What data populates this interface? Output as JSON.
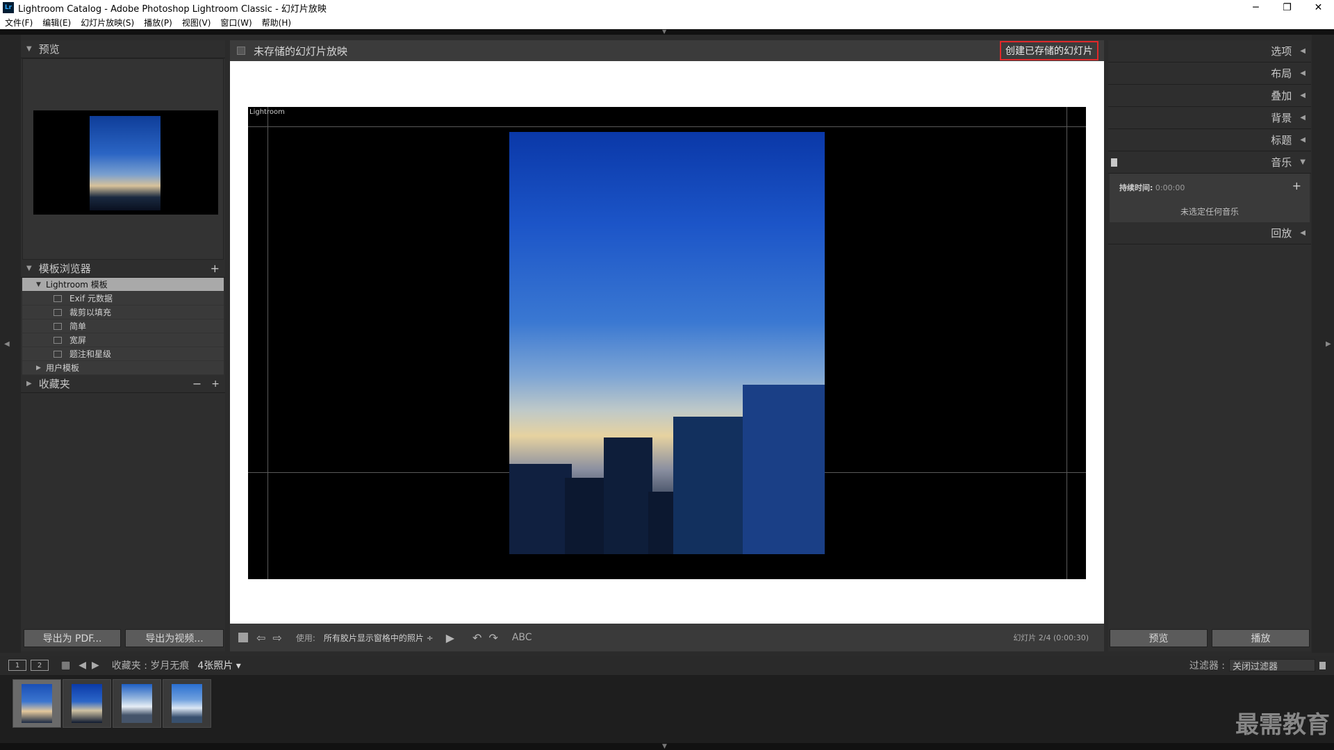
{
  "window": {
    "title": "Lightroom Catalog - Adobe Photoshop Lightroom Classic - 幻灯片放映",
    "logo": "Lr",
    "minimize": "─",
    "restore": "❐",
    "close": "✕"
  },
  "menu": [
    "文件(F)",
    "编辑(E)",
    "幻灯片放映(S)",
    "播放(P)",
    "视图(V)",
    "窗口(W)",
    "帮助(H)"
  ],
  "left": {
    "preview_title": "预览",
    "template_browser_title": "模板浏览器",
    "templates": {
      "folder": "Lightroom 模板",
      "items": [
        "Exif 元数据",
        "裁剪以填充",
        "简单",
        "宽屏",
        "题注和星级"
      ],
      "user_folder": "用户模板"
    },
    "collections_title": "收藏夹",
    "export_pdf": "导出为 PDF...",
    "export_video": "导出为视频..."
  },
  "center": {
    "title": "未存储的幻灯片放映",
    "create_button": "创建已存储的幻灯片",
    "slide_identity": "Lightroom"
  },
  "toolbar": {
    "use_label": "使用:",
    "use_value": "所有胶片显示窗格中的照片 ÷",
    "abc": "ABC",
    "counter": "幻灯片 2/4 (0:00:30)"
  },
  "right": {
    "sections": [
      "选项",
      "布局",
      "叠加",
      "背景",
      "标题",
      "音乐",
      "回放"
    ],
    "music": {
      "duration_label": "持续时间:",
      "duration_value": "0:00:00",
      "none_selected": "未选定任何音乐"
    },
    "preview_button": "预览",
    "play_button": "播放"
  },
  "filmstrip": {
    "page1": "1",
    "page2": "2",
    "collection": "收藏夹 : 岁月无痕",
    "count": "4张照片 ▾",
    "filter_label": "过滤器 :",
    "filter_value": "关闭过滤器"
  },
  "watermark": "最需教育"
}
